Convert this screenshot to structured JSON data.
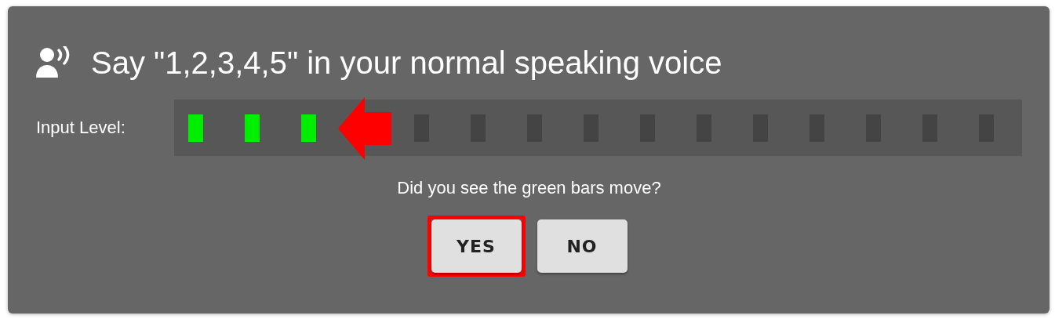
{
  "dialog": {
    "title": "Say \"1,2,3,4,5\" in your normal speaking voice",
    "meter": {
      "label": "Input Level:",
      "segments": [
        {
          "lit": true
        },
        {
          "lit": true
        },
        {
          "lit": true,
          "pointer_arrow_after": true
        },
        {
          "lit": false
        },
        {
          "lit": false
        },
        {
          "lit": false
        },
        {
          "lit": false
        },
        {
          "lit": false
        },
        {
          "lit": false
        },
        {
          "lit": false
        },
        {
          "lit": false
        },
        {
          "lit": false
        },
        {
          "lit": false
        },
        {
          "lit": false
        }
      ]
    },
    "question": "Did you see the green bars move?",
    "buttons": [
      {
        "label": "YES",
        "highlighted": true
      },
      {
        "label": "NO",
        "highlighted": false
      }
    ]
  }
}
